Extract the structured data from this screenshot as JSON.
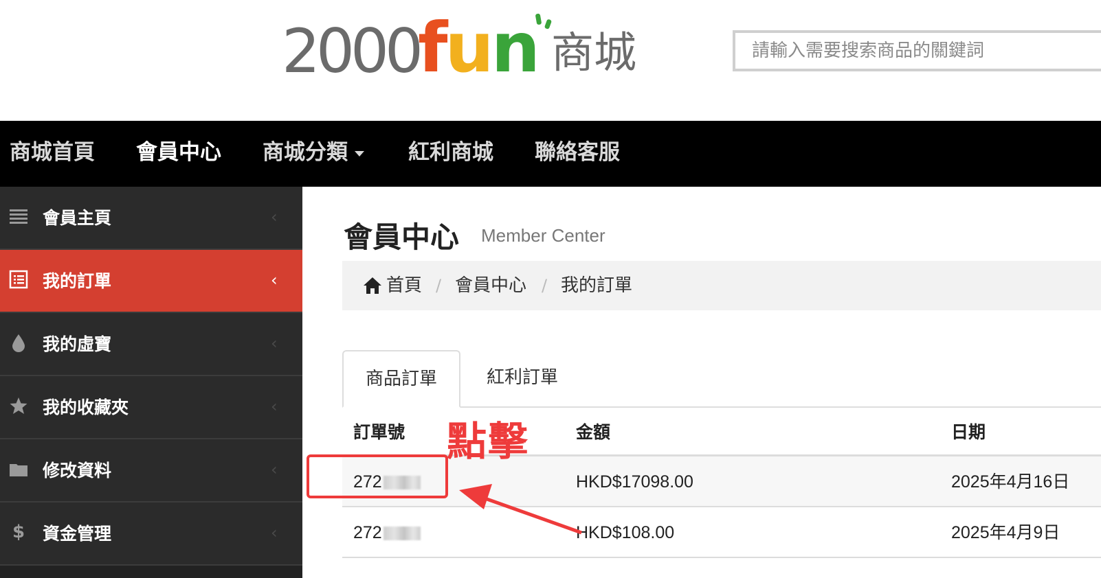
{
  "header": {
    "logo": {
      "num": "2000",
      "fun_f": "f",
      "fun_u": "u",
      "fun_n": "n",
      "mall": "商城"
    },
    "search_placeholder": "請輸入需要搜索商品的關鍵詞"
  },
  "nav": {
    "items": [
      "商城首頁",
      "會員中心",
      "商城分類",
      "紅利商城",
      "聯絡客服"
    ],
    "active": "會員中心"
  },
  "sidebar": {
    "items": [
      {
        "label": "會員主頁",
        "icon": "list-icon"
      },
      {
        "label": "我的訂單",
        "icon": "order-list-icon"
      },
      {
        "label": "我的虛寶",
        "icon": "drop-icon"
      },
      {
        "label": "我的收藏夾",
        "icon": "star-icon"
      },
      {
        "label": "修改資料",
        "icon": "folder-icon"
      },
      {
        "label": "資金管理",
        "icon": "dollar-icon"
      }
    ],
    "active": "我的訂單"
  },
  "main": {
    "title": "會員中心",
    "subtitle": "Member Center",
    "breadcrumb": [
      "首頁",
      "會員中心",
      "我的訂單"
    ],
    "tabs": [
      "商品訂單",
      "紅利訂單"
    ],
    "active_tab": "商品訂單",
    "table": {
      "headers": [
        "訂單號",
        "金額",
        "日期"
      ],
      "rows": [
        {
          "order_no": "272",
          "amount": "HKD$17098.00",
          "date": "2025年4月16日"
        },
        {
          "order_no": "272",
          "amount": "HKD$108.00",
          "date": "2025年4月9日"
        }
      ]
    }
  },
  "annotation": {
    "text": "點擊",
    "color": "#ee3b3b"
  },
  "colors": {
    "nav_bg": "#000000",
    "sidebar_bg": "#2b2b2b",
    "sidebar_active": "#d43f30",
    "logo_f": "#e8501f",
    "logo_u": "#f2b01e",
    "logo_n": "#3aa43a"
  }
}
